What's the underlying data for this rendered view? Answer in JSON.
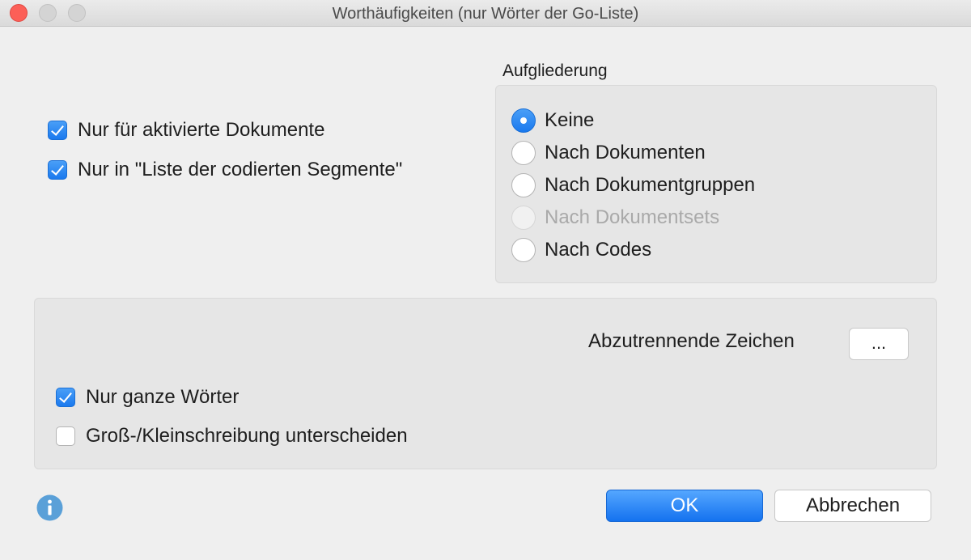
{
  "window": {
    "title": "Worthäufigkeiten (nur Wörter der Go-Liste)"
  },
  "filters": {
    "activated_documents": {
      "label": "Nur für aktivierte Dokumente",
      "checked": true
    },
    "coded_segments": {
      "label": "Nur in \"Liste der codierten Segmente\"",
      "checked": true
    }
  },
  "breakdown": {
    "title": "Aufgliederung",
    "options": [
      {
        "label": "Keine",
        "selected": true,
        "enabled": true
      },
      {
        "label": "Nach Dokumenten",
        "selected": false,
        "enabled": true
      },
      {
        "label": "Nach Dokumentgruppen",
        "selected": false,
        "enabled": true
      },
      {
        "label": "Nach Dokumentsets",
        "selected": false,
        "enabled": false
      },
      {
        "label": "Nach Codes",
        "selected": false,
        "enabled": true
      }
    ]
  },
  "options": {
    "separator_label": "Abzutrennende Zeichen",
    "separator_button": "...",
    "whole_words": {
      "label": "Nur ganze Wörter",
      "checked": true
    },
    "case_sensitive": {
      "label": "Groß-/Kleinschreibung unterscheiden",
      "checked": false
    }
  },
  "footer": {
    "info_icon": "info-icon",
    "ok_label": "OK",
    "cancel_label": "Abbrechen"
  },
  "colors": {
    "accent": "#1a79ee",
    "info": "#5aa0d8",
    "close": "#fc5f57"
  }
}
